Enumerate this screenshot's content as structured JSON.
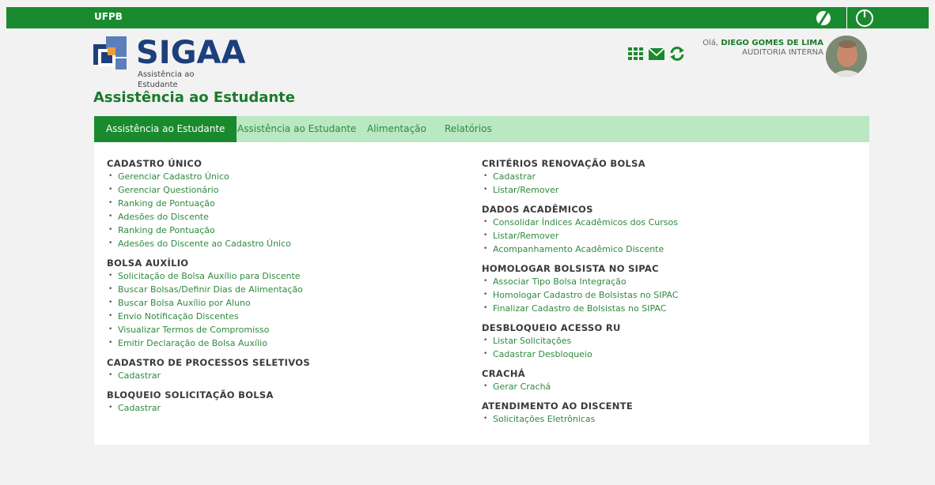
{
  "topbar": {
    "institution": "UFPB"
  },
  "header": {
    "app_title": "SIGAA",
    "app_subtitle": "Assistência ao Estudante",
    "greeting": "Olá,",
    "user_name": "DIEGO GOMES DE LIMA",
    "user_role": "AUDITORIA INTERNA"
  },
  "page": {
    "title": "Assistência ao Estudante"
  },
  "tabs": [
    {
      "label": "Assistência ao Estudante"
    },
    {
      "label": "Assistência ao Estudante"
    },
    {
      "label": "Alimentação"
    },
    {
      "label": "Relatórios"
    }
  ],
  "left_sections": [
    {
      "title": "CADASTRO ÚNICO",
      "items": [
        "Gerenciar Cadastro Único",
        "Gerenciar Questionário",
        "Ranking de Pontuação",
        "Adesões do Discente",
        "Ranking de Pontuação",
        "Adesões do Discente ao Cadastro Único"
      ]
    },
    {
      "title": "BOLSA AUXÍLIO",
      "items": [
        "Solicitação de Bolsa Auxílio para Discente",
        "Buscar Bolsas/Definir Dias de Alimentação",
        "Buscar Bolsa Auxílio por Aluno",
        "Envio Notificação Discentes",
        "Visualizar Termos de Compromisso",
        "Emitir Declaração de Bolsa Auxílio"
      ]
    },
    {
      "title": "CADASTRO DE PROCESSOS SELETIVOS",
      "items": [
        "Cadastrar"
      ]
    },
    {
      "title": "BLOQUEIO SOLICITAÇÃO BOLSA",
      "items": [
        "Cadastrar"
      ]
    }
  ],
  "right_sections": [
    {
      "title": "CRITÉRIOS RENOVAÇÃO BOLSA",
      "items": [
        "Cadastrar",
        "Listar/Remover"
      ]
    },
    {
      "title": "DADOS ACADÊMICOS",
      "items": [
        "Consolidar Índices Acadêmicos dos Cursos",
        "Listar/Remover",
        "Acompanhamento Acadêmico Discente"
      ]
    },
    {
      "title": "HOMOLOGAR BOLSISTA NO SIPAC",
      "items": [
        "Associar Tipo Bolsa Integração",
        "Homologar Cadastro de Bolsistas no SIPAC",
        "Finalizar Cadastro de Bolsistas no SIPAC"
      ]
    },
    {
      "title": "DESBLOQUEIO ACESSO RU",
      "items": [
        "Listar Solicitações",
        "Cadastrar Desbloqueio"
      ]
    },
    {
      "title": "CRACHÁ",
      "items": [
        "Gerar Crachá"
      ]
    },
    {
      "title": "ATENDIMENTO AO DISCENTE",
      "items": [
        "Solicitações Eletrônicas"
      ]
    }
  ],
  "colors": {
    "brand_green": "#1a8a2e",
    "tab_bar": "#b9e8c2",
    "link_green": "#2f8a3e",
    "logo_blue": "#1d3f7a"
  },
  "icons": [
    "contrast-icon",
    "power-icon",
    "apps-grid-icon",
    "mail-icon",
    "refresh-icon"
  ]
}
